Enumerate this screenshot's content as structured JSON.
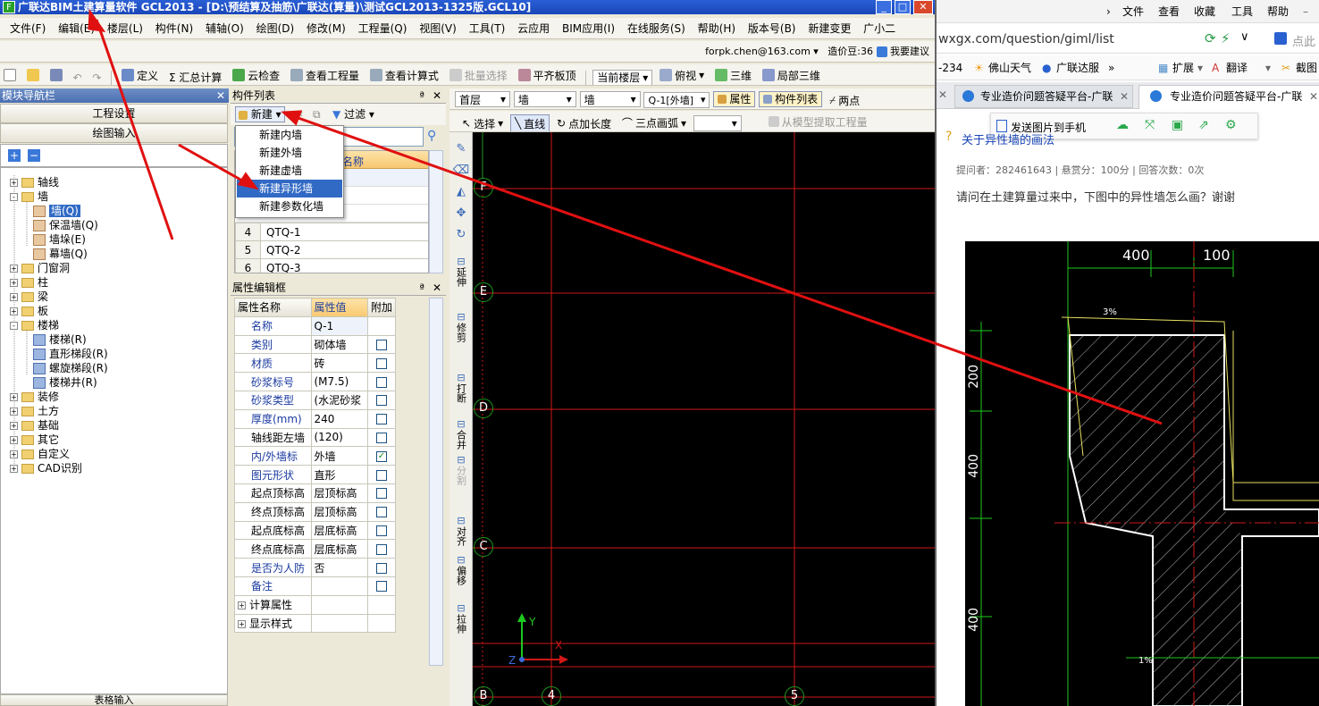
{
  "app": {
    "title": "广联达BIM土建算量软件 GCL2013 - [D:\\预结算及抽筋\\广联达(算量)\\测试GCL2013-1325版.GCL10]",
    "icon": "app-logo-icon"
  },
  "menu": [
    "文件(F)",
    "编辑(E)",
    "楼层(L)",
    "构件(N)",
    "辅轴(O)",
    "绘图(D)",
    "修改(M)",
    "工程量(Q)",
    "视图(V)",
    "工具(T)",
    "云应用",
    "BIM应用(I)",
    "在线服务(S)",
    "帮助(H)",
    "版本号(B)",
    "新建变更",
    "广小二"
  ],
  "userbar": {
    "email": "forpk.chen@163.com",
    "coins": "造价豆:36",
    "suggest": "我要建议"
  },
  "toolbar1": [
    "定义",
    "Σ 汇总计算",
    "云检查",
    "查看工程量",
    "查看计算式",
    "批量选择",
    "平齐板顶",
    "当前楼层",
    "俯视",
    "三维",
    "局部三维"
  ],
  "toolbar2": {
    "floor": "首层",
    "type1": "墙",
    "type2": "墙",
    "component": "Q-1[外墙]",
    "props_btn": "属性",
    "list_btn": "构件列表",
    "two_point": "两点"
  },
  "toolbar3": [
    "选择",
    "直线",
    "点加长度",
    "三点画弧"
  ],
  "extract_btn": "从模型提取工程量",
  "nav": {
    "title": "模块导航栏",
    "btn1": "工程设置",
    "btn2": "绘图输入",
    "footer": "表格输入",
    "tree": [
      {
        "label": "轴线",
        "level": 0,
        "exp": "+"
      },
      {
        "label": "墙",
        "level": 0,
        "exp": "-"
      },
      {
        "label": "墙(Q)",
        "level": 1,
        "sel": true
      },
      {
        "label": "保温墙(Q)",
        "level": 1
      },
      {
        "label": "墙垛(E)",
        "level": 1
      },
      {
        "label": "幕墙(Q)",
        "level": 1
      },
      {
        "label": "门窗洞",
        "level": 0,
        "exp": "+"
      },
      {
        "label": "柱",
        "level": 0,
        "exp": "+"
      },
      {
        "label": "梁",
        "level": 0,
        "exp": "+"
      },
      {
        "label": "板",
        "level": 0,
        "exp": "+"
      },
      {
        "label": "楼梯",
        "level": 0,
        "exp": "-"
      },
      {
        "label": "楼梯(R)",
        "level": 1,
        "blue": true
      },
      {
        "label": "直形梯段(R)",
        "level": 1,
        "blue": true
      },
      {
        "label": "螺旋梯段(R)",
        "level": 1,
        "blue": true
      },
      {
        "label": "楼梯井(R)",
        "level": 1,
        "blue": true
      },
      {
        "label": "装修",
        "level": 0,
        "exp": "+"
      },
      {
        "label": "土方",
        "level": 0,
        "exp": "+"
      },
      {
        "label": "基础",
        "level": 0,
        "exp": "+"
      },
      {
        "label": "其它",
        "level": 0,
        "exp": "+"
      },
      {
        "label": "自定义",
        "level": 0,
        "exp": "+"
      },
      {
        "label": "CAD识别",
        "level": 0,
        "exp": "+"
      }
    ]
  },
  "complist": {
    "title": "构件列表",
    "new_btn": "新建",
    "filter_btn": "过滤",
    "header_name": "名称",
    "rows": [
      {
        "num": "4",
        "name": "QTQ-1"
      },
      {
        "num": "5",
        "name": "QTQ-2"
      },
      {
        "num": "6",
        "name": "QTQ-3"
      }
    ],
    "menu": [
      "新建内墙",
      "新建外墙",
      "新建虚墙",
      "新建异形墙",
      "新建参数化墙"
    ]
  },
  "props": {
    "title": "属性编辑框",
    "headers": [
      "属性名称",
      "属性值",
      "附加"
    ],
    "rows": [
      {
        "k": "名称",
        "v": "Q-1",
        "c": ""
      },
      {
        "k": "类别",
        "v": "砌体墙",
        "c": "box"
      },
      {
        "k": "材质",
        "v": "砖",
        "c": "box"
      },
      {
        "k": "砂浆标号",
        "v": "(M7.5)",
        "c": "box"
      },
      {
        "k": "砂浆类型",
        "v": "(水泥砂浆",
        "c": "box"
      },
      {
        "k": "厚度(mm)",
        "v": "240",
        "c": "box"
      },
      {
        "k": "轴线距左墙",
        "v": "(120)",
        "c": "box",
        "black": true
      },
      {
        "k": "内/外墙标",
        "v": "外墙",
        "c": "check"
      },
      {
        "k": "图元形状",
        "v": "直形",
        "c": "box"
      },
      {
        "k": "起点顶标高",
        "v": "层顶标高",
        "c": "box",
        "black": true
      },
      {
        "k": "终点顶标高",
        "v": "层顶标高",
        "c": "box",
        "black": true
      },
      {
        "k": "起点底标高",
        "v": "层底标高",
        "c": "box",
        "black": true
      },
      {
        "k": "终点底标高",
        "v": "层底标高",
        "c": "box",
        "black": true
      },
      {
        "k": "是否为人防",
        "v": "否",
        "c": "box"
      },
      {
        "k": "备注",
        "v": "",
        "c": "box"
      },
      {
        "k": "计算属性",
        "v": "",
        "c": "",
        "group": true
      },
      {
        "k": "显示样式",
        "v": "",
        "c": "",
        "group": true
      }
    ]
  },
  "vtools": [
    "延伸",
    "修剪",
    "打断",
    "合并",
    "分割",
    "对齐",
    "偏移",
    "拉伸"
  ],
  "canvas": {
    "axes_h": [
      "F",
      "E",
      "D",
      "C",
      "B"
    ],
    "axes_v": [
      "4",
      "5"
    ],
    "ucs_y": "Y",
    "ucs_x": "X",
    "ucs_z": "Z"
  },
  "browser": {
    "menu": [
      "文件",
      "查看",
      "收藏",
      "工具",
      "帮助"
    ],
    "url": "wxgx.com/question/giml/list",
    "search": "点此",
    "bookmarks": [
      "-234",
      "佛山天气",
      "广联达服",
      "扩展",
      "翻译",
      "截图"
    ],
    "tabs": [
      "专业造价问题答疑平台-广联",
      "专业造价问题答疑平台-广联"
    ],
    "send_phone": "发送图片到手机",
    "question_title": "关于异性墙的画法",
    "meta": "提问者：282461643  |  悬赏分：100分  |  回答次数：0次",
    "body": "请问在土建算量过来中，下图中的异性墙怎么画？谢谢",
    "dims": [
      "400",
      "100"
    ],
    "slope1": "3%",
    "slope2": "1%",
    "vdims": [
      "200",
      "400",
      "400"
    ]
  }
}
